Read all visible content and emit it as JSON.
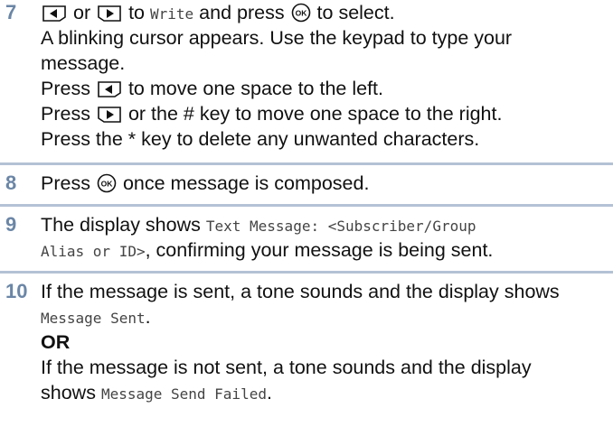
{
  "steps": [
    {
      "number": "7",
      "lines": {
        "l1": {
          "a": "or",
          "b": "to",
          "c": "Write",
          "d": "and press",
          "e": "to select."
        },
        "l2": "A blinking cursor appears. Use the keypad to type your",
        "l3": "message.",
        "l4": {
          "a": "Press",
          "b": "to move one space to the left."
        },
        "l5": {
          "a": "Press",
          "b": "or the # key to move one space to the right."
        },
        "l6": "Press the * key to delete any unwanted characters."
      }
    },
    {
      "number": "8",
      "lines": {
        "a": "Press",
        "b": "once message is composed."
      }
    },
    {
      "number": "9",
      "lines": {
        "l1": {
          "a": "The display shows",
          "b": "Text Message: <Subscriber/Group"
        },
        "l2": {
          "a": "Alias or ID>",
          "b": ", confirming your message is being sent."
        }
      }
    },
    {
      "number": "10",
      "lines": {
        "l1": "If the message is sent, a tone sounds and the display shows",
        "l2": {
          "a": "Message Sent",
          "b": "."
        },
        "l3": "OR",
        "l4": "If the message is not sent, a tone sounds and the display",
        "l5": {
          "a": "shows",
          "b": "Message Send Failed",
          "c": "."
        }
      }
    }
  ],
  "icons": {
    "left": "left-arrow-key-icon",
    "right": "right-arrow-key-icon",
    "ok": "ok-key-icon"
  },
  "colors": {
    "step_number": "#6b86a6",
    "separator": "#b4c2d5"
  }
}
